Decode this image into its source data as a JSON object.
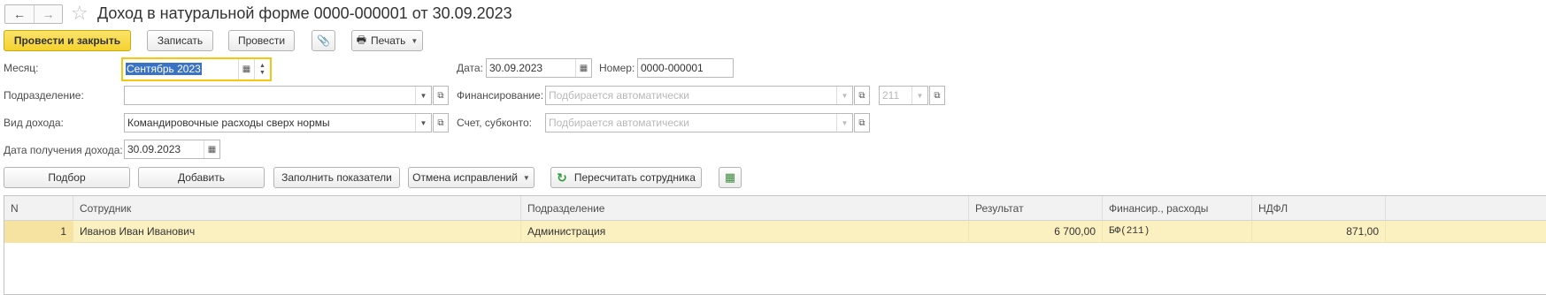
{
  "header": {
    "back_icon": "←",
    "forward_icon": "→",
    "star_icon": "☆",
    "title": "Доход в натуральной форме 0000-000001 от 30.09.2023"
  },
  "toolbar": {
    "post_close_label": "Провести и закрыть",
    "save_label": "Записать",
    "post_label": "Провести",
    "attach_icon": "📎",
    "print_icon": "🖶",
    "print_label": "Печать"
  },
  "form": {
    "month_label": "Месяц:",
    "month_value": "Сентябрь 2023",
    "date_label": "Дата:",
    "date_value": "30.09.2023",
    "number_label": "Номер:",
    "number_value": "0000-000001",
    "division_label": "Подразделение:",
    "division_value": "",
    "financing_label": "Финансирование:",
    "financing_placeholder": "Подбирается автоматически",
    "kosgu_placeholder": "211",
    "income_type_label": "Вид дохода:",
    "income_type_value": "Командировочные расходы сверх нормы",
    "account_label": "Счет, субконто:",
    "account_placeholder": "Подбирается автоматически",
    "receipt_date_label": "Дата получения дохода:",
    "receipt_date_value": "30.09.2023"
  },
  "icons": {
    "calendar_icon": "▦",
    "dropdown_icon": "▼",
    "open_icon": "⧉",
    "spin_up_icon": "▲",
    "spin_down_icon": "▼",
    "refresh_icon": "↻",
    "table_settings_icon": "▦"
  },
  "actions": {
    "pick_label": "Подбор",
    "add_label": "Добавить",
    "fill_label": "Заполнить показатели",
    "cancel_corrections_label": "Отмена исправлений",
    "recalc_label": "Пересчитать сотрудника"
  },
  "table": {
    "columns": [
      "N",
      "Сотрудник",
      "Подразделение",
      "Результат",
      "Финансир., расходы",
      "НДФЛ"
    ],
    "rows": [
      [
        "1",
        "Иванов Иван Иванович",
        "Администрация",
        "6 700,00",
        "БФ(211)",
        "871,00"
      ]
    ]
  },
  "colors": {
    "primary_button": "#f5d22f",
    "selected_row": "#fbf0bf",
    "focus_border": "#f5c70f",
    "selection": "#3a72c6"
  }
}
